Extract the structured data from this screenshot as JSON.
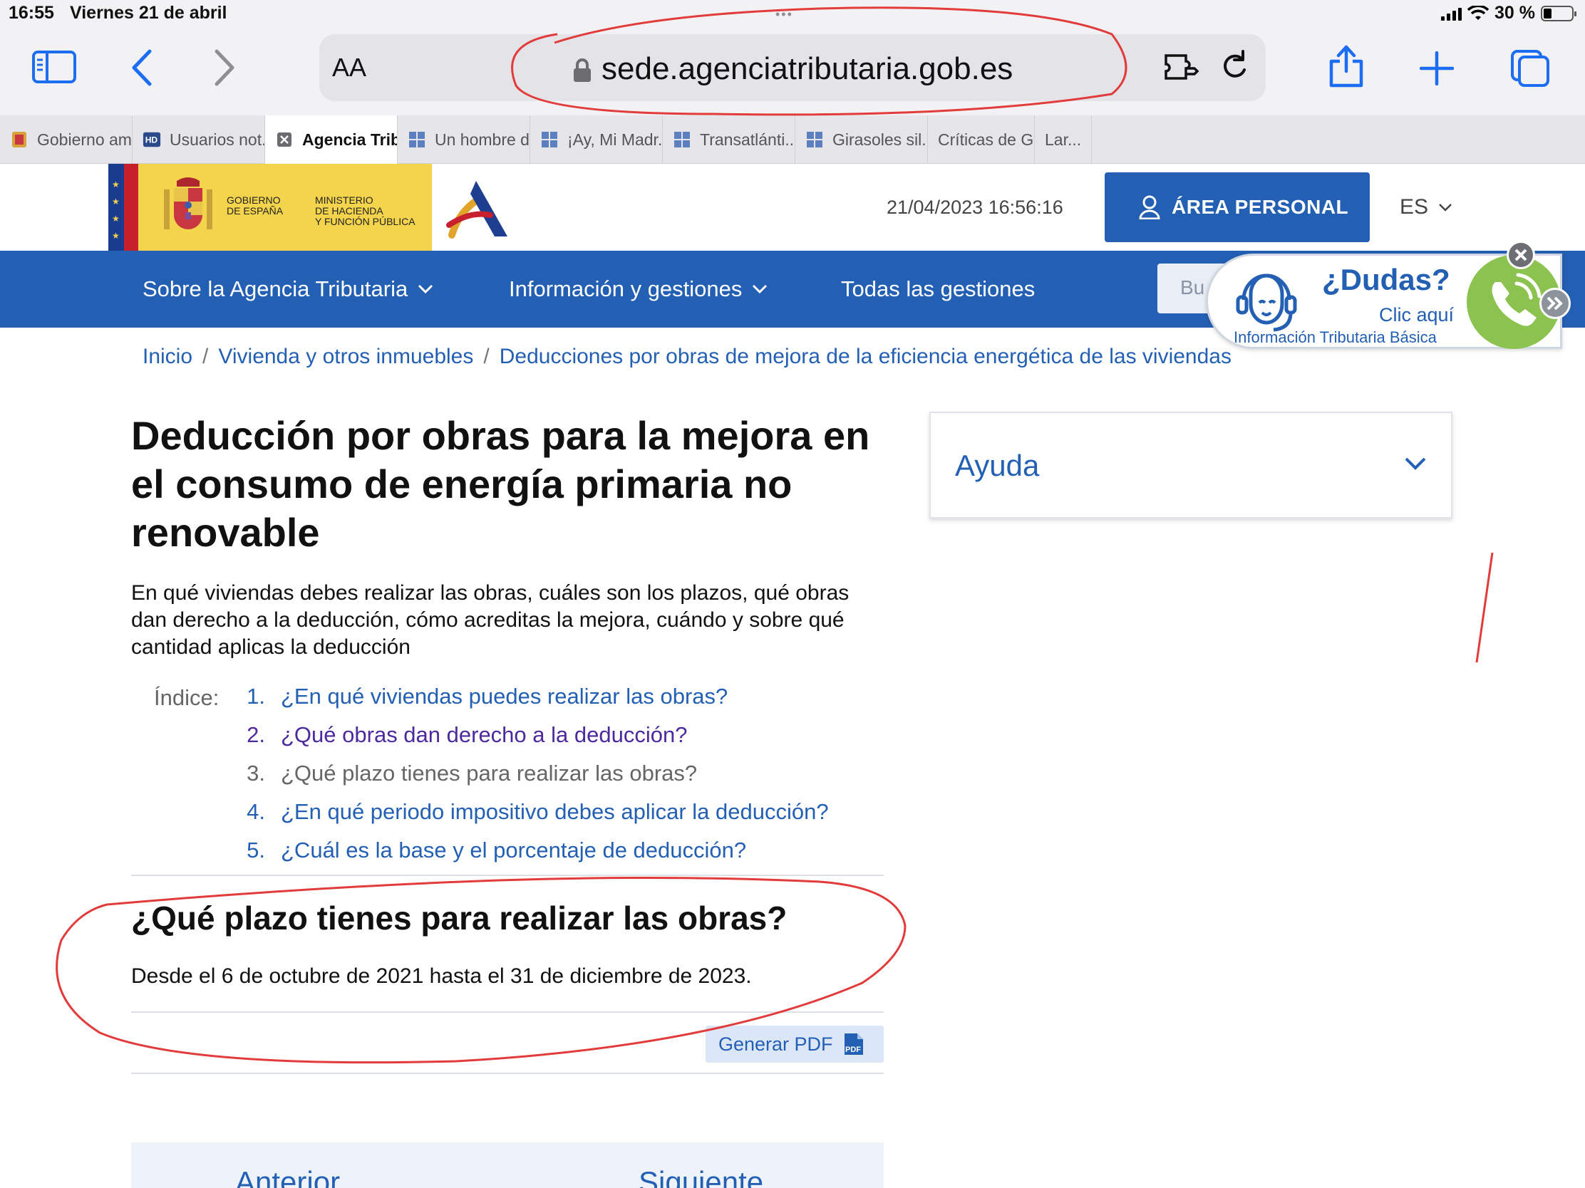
{
  "status_bar": {
    "time": "16:55",
    "date": "Viernes 21 de abril",
    "battery": "30 %",
    "battery_level": 0.3
  },
  "browser": {
    "text_size_label": "AA",
    "url": "sede.agenciatributaria.gob.es",
    "tabs": [
      {
        "label": "Gobierno am...",
        "icon": "spain-shield-icon",
        "active": false
      },
      {
        "label": "Usuarios not...",
        "icon": "hd-icon",
        "active": false
      },
      {
        "label": "Agencia Trib...",
        "icon": "close-icon",
        "active": true
      },
      {
        "label": "Un hombre d...",
        "icon": "grid-icon",
        "active": false
      },
      {
        "label": "¡Ay, Mi Madr...",
        "icon": "grid-icon",
        "active": false
      },
      {
        "label": "Transatlánti...",
        "icon": "grid-icon",
        "active": false
      },
      {
        "label": "Girasoles sil...",
        "icon": "grid-icon",
        "active": false
      },
      {
        "label": "Críticas de G...",
        "icon": "",
        "active": false
      },
      {
        "label": "Lar...",
        "icon": "",
        "active": false
      }
    ]
  },
  "header": {
    "gov_line1": "GOBIERNO",
    "gov_line2": "DE ESPAÑA",
    "ministry_line1": "MINISTERIO",
    "ministry_line2": "DE HACIENDA",
    "ministry_line3": "Y FUNCIÓN PÚBLICA",
    "datetime": "21/04/2023 16:56:16",
    "area_personal": "ÁREA PERSONAL",
    "language": "ES"
  },
  "nav": {
    "items": [
      {
        "label": "Sobre la Agencia Tributaria",
        "dropdown": true
      },
      {
        "label": "Información y gestiones",
        "dropdown": true
      },
      {
        "label": "Todas las gestiones",
        "dropdown": false
      }
    ],
    "search_placeholder": "Bu"
  },
  "dudas_widget": {
    "title": "¿Dudas?",
    "subtitle": "Clic aquí",
    "info": "Información Tributaria Básica"
  },
  "breadcrumb": [
    "Inicio",
    "Vivienda y otros inmuebles",
    "Deducciones por obras de mejora de la eficiencia energética de las viviendas"
  ],
  "main": {
    "title": "Deducción por obras para la mejora en el consumo de energía primaria no renovable",
    "lead": "En qué viviendas debes realizar las obras, cuáles son los plazos, qué obras dan derecho a la deducción, cómo acreditas la mejora, cuándo y sobre qué cantidad aplicas la deducción",
    "index_label": "Índice:",
    "index": [
      {
        "n": "1.",
        "text": "¿En qué viviendas puedes realizar las obras?",
        "state": "link"
      },
      {
        "n": "2.",
        "text": "¿Qué obras dan derecho a la deducción?",
        "state": "visited"
      },
      {
        "n": "3.",
        "text": "¿Qué plazo tienes para realizar las obras?",
        "state": "current"
      },
      {
        "n": "4.",
        "text": "¿En qué periodo impositivo debes aplicar la deducción?",
        "state": "link"
      },
      {
        "n": "5.",
        "text": "¿Cuál es la base y el porcentaje de deducción?",
        "state": "link"
      }
    ],
    "section_title": "¿Qué plazo tienes para realizar las obras?",
    "section_text": "Desde el 6 de octubre de 2021 hasta el 31 de diciembre de 2023.",
    "pdf_button": "Generar PDF",
    "prev_label": "Anterior",
    "next_label": "Siguiente"
  },
  "aside": {
    "ayuda_label": "Ayuda"
  },
  "colors": {
    "brand_blue": "#235fb3",
    "safari_blue": "#1d6df2",
    "annotation_red": "#e23b3b",
    "visited": "#4c2a9e"
  }
}
